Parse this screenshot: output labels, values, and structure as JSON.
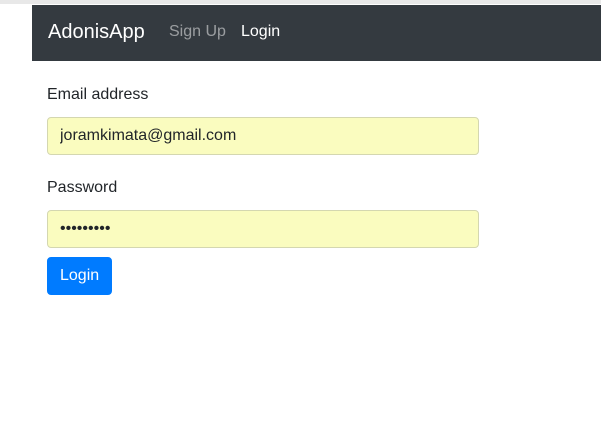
{
  "navbar": {
    "brand": "AdonisApp",
    "links": [
      {
        "label": "Sign Up",
        "active": false
      },
      {
        "label": "Login",
        "active": true
      }
    ]
  },
  "form": {
    "email": {
      "label": "Email address",
      "value": "joramkimata@gmail.com",
      "placeholder": ""
    },
    "password": {
      "label": "Password",
      "value": "123456789",
      "masked_display": "•••••••••"
    },
    "submit_label": "Login"
  },
  "colors": {
    "navbar_bg": "#343a40",
    "autofill_bg": "#fafcbf",
    "primary": "#007bff"
  }
}
